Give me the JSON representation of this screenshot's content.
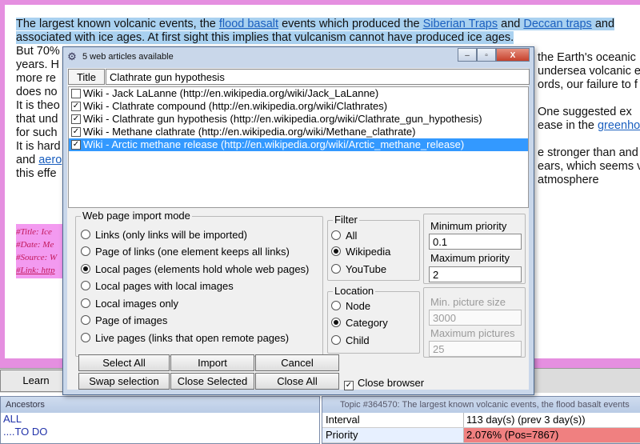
{
  "document": {
    "line1": {
      "t1": "The largest known volcanic events, the ",
      "l1": "flood basalt",
      "t2": " events which produced the ",
      "l2": "Siberian Traps",
      "t3": " and ",
      "l3": "Deccan traps",
      "t4": " and"
    },
    "line2": "associated with ice ages. At first sight this implies that vulcanism cannot have produced ice ages.",
    "line3_left": "But 70%",
    "line3_right": "the Earth's oceanic",
    "line4_left": "years. H",
    "line4_right": "undersea volcanic e",
    "line5_left": "more re",
    "line5_right": "ords, our failure to f",
    "line6_left": "does no",
    "line7_left": "It is theo",
    "line7_right": "One suggested ex",
    "line8_left": "that und",
    "line8_right_text": "ease in the ",
    "line8_right_link": "greenho",
    "line9_left": "for such",
    "line10_left": "It is hard",
    "line10_right": "e stronger than and",
    "line11_left_text": "and ",
    "line11_left_link": "aero",
    "line11_right": "ears, which seems v",
    "line12_left": "this effe",
    "line12_right": "atmosphere",
    "meta": [
      "#Title: Ice",
      "#Date: Me",
      "#Source: W",
      "#Link: http"
    ]
  },
  "learn_button": "Learn",
  "ancestors": {
    "title": "Ancestors",
    "items": [
      "ALL",
      "....TO DO"
    ]
  },
  "topic_panel": {
    "title": "Topic #364570: The largest known volcanic events, the flood basalt events",
    "rows": [
      {
        "key": "Interval",
        "value": "113 day(s) (prev 3 day(s))"
      },
      {
        "key": "Priority",
        "value": "2.076% (Pos=7867)"
      }
    ],
    "priority_color": "#f08080"
  },
  "dialog": {
    "title": "5 web articles available",
    "window_buttons": {
      "minimize": "–",
      "maximize": "▫",
      "close": "X"
    },
    "title_header": "Title",
    "title_value": "Clathrate gun hypothesis",
    "articles": [
      {
        "label": "Wiki - Jack LaLanne (http://en.wikipedia.org/wiki/Jack_LaLanne)",
        "checked": false,
        "selected": false
      },
      {
        "label": "Wiki - Clathrate compound (http://en.wikipedia.org/wiki/Clathrates)",
        "checked": true,
        "selected": false
      },
      {
        "label": "Wiki - Clathrate gun hypothesis (http://en.wikipedia.org/wiki/Clathrate_gun_hypothesis)",
        "checked": true,
        "selected": false
      },
      {
        "label": "Wiki - Methane clathrate (http://en.wikipedia.org/wiki/Methane_clathrate)",
        "checked": true,
        "selected": false
      },
      {
        "label": "Wiki - Arctic methane release (http://en.wikipedia.org/wiki/Arctic_methane_release)",
        "checked": true,
        "selected": true
      }
    ],
    "import_mode": {
      "title": "Web page import mode",
      "options": [
        "Links (only links will be imported)",
        "Page of links (one element keeps all links)",
        "Local pages (elements hold whole web pages)",
        "Local pages with local images",
        "Local images only",
        "Page of images",
        "Live pages (links that open remote pages)"
      ],
      "selected_index": 2
    },
    "filter": {
      "title": "Filter",
      "options": [
        "All",
        "Wikipedia",
        "YouTube"
      ],
      "selected_index": 1
    },
    "location": {
      "title": "Location",
      "options": [
        "Node",
        "Category",
        "Child"
      ],
      "selected_index": 1
    },
    "priority": {
      "min_label": "Minimum priority",
      "min_value": "0.1",
      "max_label": "Maximum priority",
      "max_value": "2"
    },
    "pictures": {
      "min_size_label": "Min. picture size",
      "min_size_value": "3000",
      "max_label": "Maximum pictures",
      "max_value": "25"
    },
    "buttons": {
      "select_all": "Select All",
      "import": "Import",
      "cancel": "Cancel",
      "swap_selection": "Swap selection",
      "close_selected": "Close Selected",
      "close_all": "Close All"
    },
    "close_browser": {
      "label": "Close browser",
      "checked": true
    }
  }
}
